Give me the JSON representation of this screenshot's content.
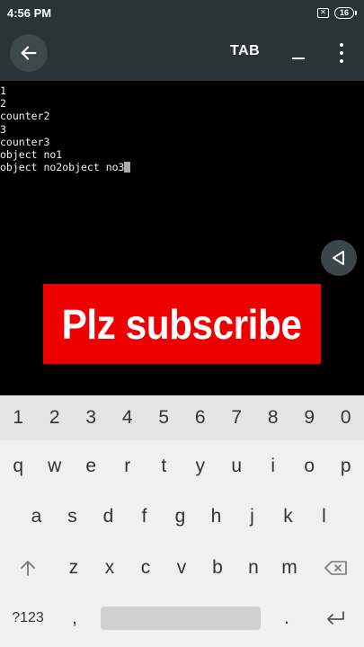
{
  "status_bar": {
    "time": "4:56 PM",
    "sim_glyph": "✕",
    "battery_level": "16"
  },
  "toolbar": {
    "back_icon": "arrow-left-icon",
    "tab_label": "TAB",
    "underscore_icon": "underscore-icon",
    "more_icon": "more-vert-icon"
  },
  "terminal": {
    "lines": [
      "1",
      "2",
      "counter2",
      "3",
      "counter3",
      "object no1",
      "object no2object no3"
    ]
  },
  "side_fab_icon": "triangle-left-icon",
  "banner": {
    "text": "Plz subscribe",
    "color": "#ee0000"
  },
  "keyboard": {
    "number_row": [
      "1",
      "2",
      "3",
      "4",
      "5",
      "6",
      "7",
      "8",
      "9",
      "0"
    ],
    "row1": [
      "q",
      "w",
      "e",
      "r",
      "t",
      "y",
      "u",
      "i",
      "o",
      "p"
    ],
    "row2": [
      "a",
      "s",
      "d",
      "f",
      "g",
      "h",
      "j",
      "k",
      "l"
    ],
    "row3": [
      "z",
      "x",
      "c",
      "v",
      "b",
      "n",
      "m"
    ],
    "symbols_label": "?123",
    "comma_label": ",",
    "period_label": ".",
    "shift_icon": "shift-arrow-icon",
    "backspace_icon": "backspace-icon",
    "enter_icon": "enter-icon"
  }
}
